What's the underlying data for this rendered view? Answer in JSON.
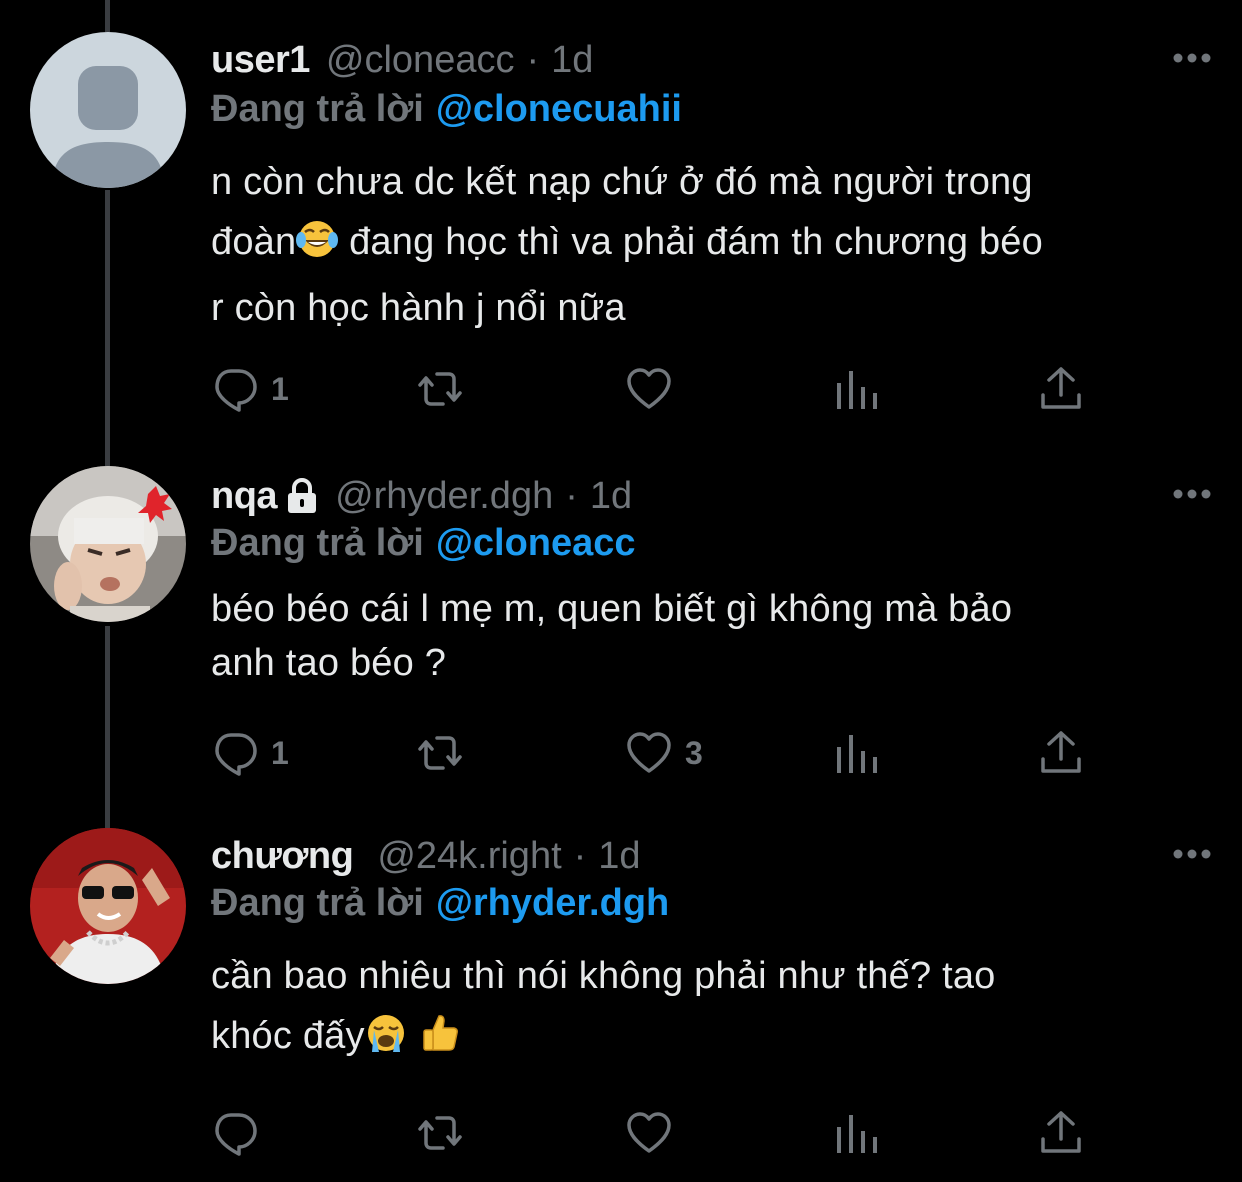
{
  "thread": {
    "reply_prefix": "Đang trả lời",
    "tweets": [
      {
        "name": "user1",
        "handle": "@cloneacc",
        "separator": "·",
        "time": "1d",
        "reply_to": "@clonecuahii",
        "text_lines": [
          "n còn chưa dc kết nạp chứ ở đó mà người trong",
          "đoàn",
          " đang học thì va phải đám th chương béo",
          "r còn học hành j nổi nữa"
        ],
        "emoji": "face-with-tears-of-joy",
        "reply_count": "1",
        "like_count": "",
        "protected": false
      },
      {
        "name": "nqa",
        "handle": "@rhyder.dgh",
        "separator": "·",
        "time": "1d",
        "reply_to": "@cloneacc",
        "text_lines": [
          "béo béo cái l mẹ m, quen biết gì không mà bảo",
          "anh tao béo ?"
        ],
        "reply_count": "1",
        "like_count": "3",
        "protected": true
      },
      {
        "name": "chương",
        "handle": "@24k.right",
        "separator": "·",
        "time": "1d",
        "reply_to": "@rhyder.dgh",
        "text_lines": [
          "cần bao nhiêu thì nói không phải như thế? tao",
          "khóc đấy"
        ],
        "emojis": [
          "loudly-crying-face",
          "thumbs-up"
        ],
        "reply_count": "",
        "like_count": "",
        "protected": false
      }
    ]
  },
  "colors": {
    "background": "#000000",
    "primary_text": "#e7e9ea",
    "secondary_text": "#71767b",
    "mention": "#1d9bf0",
    "thread_line": "#3a3d41"
  },
  "icons": [
    "reply-icon",
    "retweet-icon",
    "like-icon",
    "views-icon",
    "share-icon",
    "more-icon",
    "lock-icon"
  ]
}
